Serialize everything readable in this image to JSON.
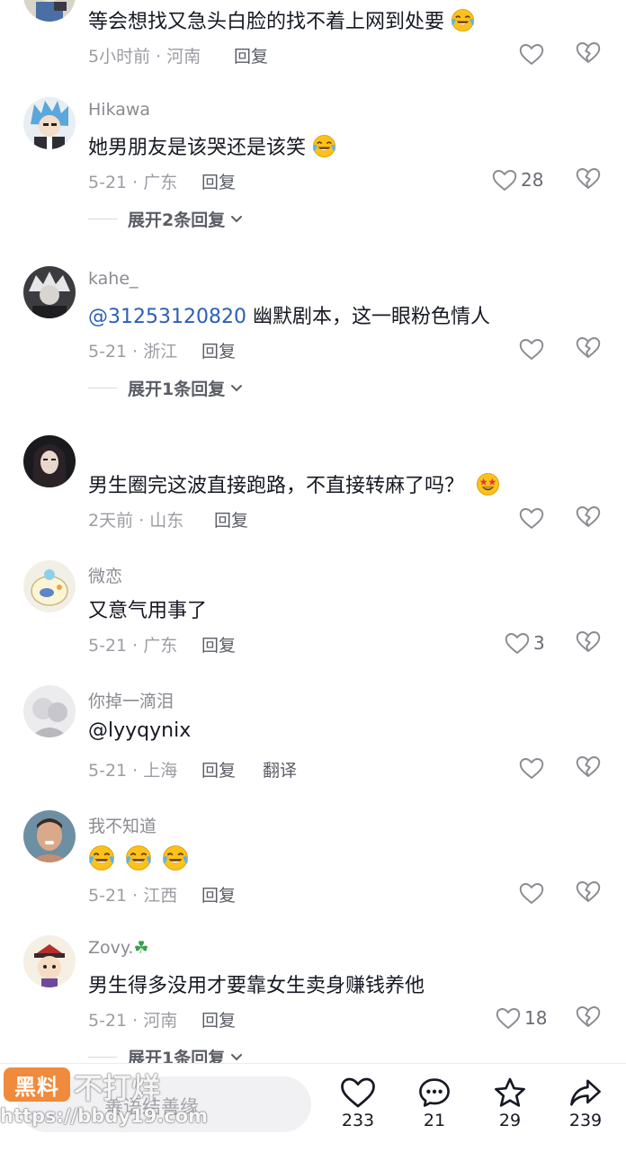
{
  "colors": {
    "mention": "#2b5fb6",
    "meta": "#9c9da3",
    "text": "#161823"
  },
  "comments": [
    {
      "username": "",
      "content": "等会想找又急头白脸的找不着上网到处要",
      "emoji": [
        "laugh-cry-emoji"
      ],
      "meta": "5小时前 · 河南",
      "reply": "回复",
      "likes": ""
    },
    {
      "username": "Hikawa",
      "content": "她男朋友是该哭还是该笑",
      "emoji": [
        "laugh-cry-emoji"
      ],
      "meta": "5-21 · 广东",
      "reply": "回复",
      "likes": "28",
      "expand": "展开2条回复"
    },
    {
      "username": "kahe_",
      "mention": "@31253120820",
      "content": " 幽默剧本，这一眼粉色情人",
      "meta": "5-21 · 浙江",
      "reply": "回复",
      "likes": "",
      "expand": "展开1条回复"
    },
    {
      "username": "",
      "content": "男生圈完这波直接跑路，不直接转麻了吗？",
      "emoji": [
        "star-eyes-emoji"
      ],
      "meta": "2天前 · 山东",
      "reply": "回复",
      "likes": ""
    },
    {
      "username": "微恋",
      "content": "又意气用事了",
      "meta": "5-21 · 广东",
      "reply": "回复",
      "likes": "3"
    },
    {
      "username": "你掉一滴泪",
      "mention": "@lyyqynix",
      "content": "",
      "meta": "5-21 · 上海",
      "reply": "回复",
      "translate": "翻译",
      "likes": ""
    },
    {
      "username": "我不知道",
      "content": "",
      "emoji": [
        "laugh-cry-emoji",
        "laugh-cry-emoji",
        "laugh-cry-emoji"
      ],
      "meta": "5-21 · 江西",
      "reply": "回复",
      "likes": ""
    },
    {
      "username": "Zovy.",
      "username_icon": "clover-icon",
      "content": "男生得多没用才要靠女生卖身赚钱养他",
      "meta": "5-21 · 河南",
      "reply": "回复",
      "likes": "18",
      "expand": "展开1条回复"
    }
  ],
  "bottom_bar": {
    "input_placeholder": "善语结善缘",
    "watermark_badge": "黑料",
    "watermark_title": "不打烊",
    "watermark_url": "https://bbdy19.com",
    "actions": [
      {
        "icon": "heart-icon",
        "count": "233"
      },
      {
        "icon": "comment-icon",
        "count": "21"
      },
      {
        "icon": "star-icon",
        "count": "29"
      },
      {
        "icon": "share-icon",
        "count": "239"
      }
    ]
  }
}
